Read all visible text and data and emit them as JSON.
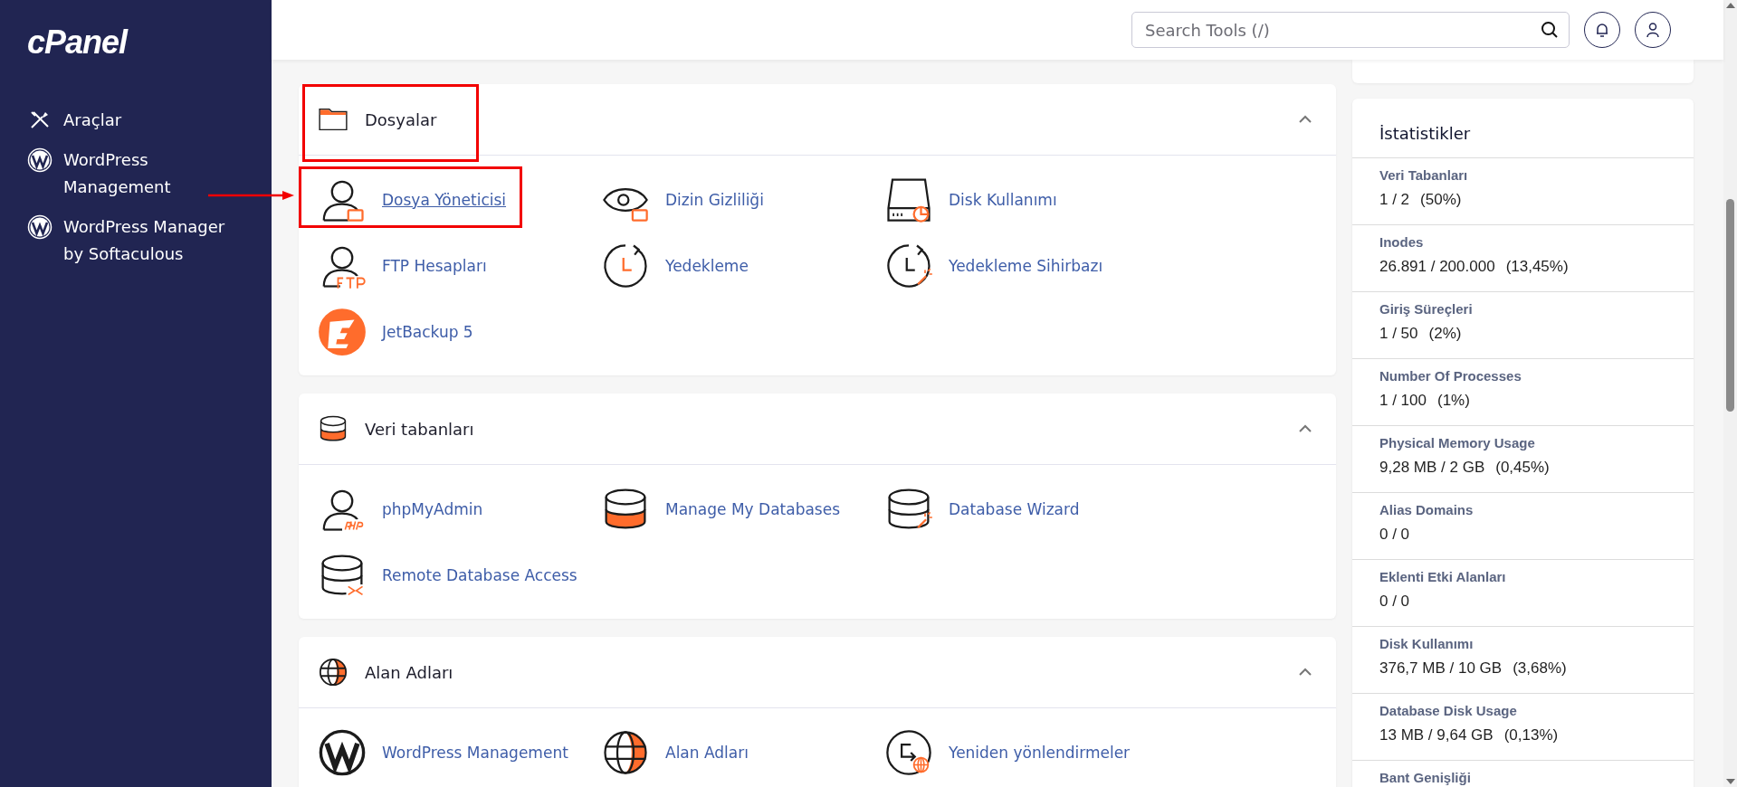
{
  "sidebar": {
    "logo": "cPanel",
    "items": [
      {
        "label": "Araçlar"
      },
      {
        "label": "WordPress Management"
      },
      {
        "label": "WordPress Manager by Softaculous"
      }
    ]
  },
  "header": {
    "search": {
      "placeholder": "Search Tools (/)"
    }
  },
  "sections": [
    {
      "title": "Dosyalar",
      "expanded": true,
      "highlighted": true,
      "items": [
        {
          "label": "Dosya Yöneticisi",
          "highlighted": true
        },
        {
          "label": "Dizin Gizliliği",
          "highlighted": false
        },
        {
          "label": "Disk Kullanımı",
          "highlighted": false
        },
        {
          "label": "FTP Hesapları",
          "highlighted": false
        },
        {
          "label": "Yedekleme",
          "highlighted": false
        },
        {
          "label": "Yedekleme Sihirbazı",
          "highlighted": false
        },
        {
          "label": "JetBackup 5",
          "highlighted": false
        }
      ]
    },
    {
      "title": "Veri tabanları",
      "expanded": true,
      "highlighted": false,
      "items": [
        {
          "label": "phpMyAdmin",
          "highlighted": false
        },
        {
          "label": "Manage My Databases",
          "highlighted": false
        },
        {
          "label": "Database Wizard",
          "highlighted": false
        },
        {
          "label": "Remote Database Access",
          "highlighted": false
        }
      ]
    },
    {
      "title": "Alan Adları",
      "expanded": true,
      "highlighted": false,
      "items": [
        {
          "label": "WordPress Management",
          "highlighted": false
        },
        {
          "label": "Alan Adları",
          "highlighted": false
        },
        {
          "label": "Yeniden yönlendirmeler",
          "highlighted": false
        }
      ]
    }
  ],
  "stats": {
    "title": "İstatistikler",
    "rows": [
      {
        "label": "Veri Tabanları",
        "value": "1 / 2",
        "percent": "(50%)"
      },
      {
        "label": "Inodes",
        "value": "26.891 / 200.000",
        "percent": "(13,45%)"
      },
      {
        "label": "Giriş Süreçleri",
        "value": "1 / 50",
        "percent": "(2%)"
      },
      {
        "label": "Number Of Processes",
        "value": "1 / 100",
        "percent": "(1%)"
      },
      {
        "label": "Physical Memory Usage",
        "value": "9,28 MB / 2 GB",
        "percent": "(0,45%)"
      },
      {
        "label": "Alias Domains",
        "value": "0 / 0"
      },
      {
        "label": "Eklenti Etki Alanları",
        "value": "0 / 0"
      },
      {
        "label": "Disk Kullanımı",
        "value": "376,7 MB / 10 GB",
        "percent": "(3,68%)"
      },
      {
        "label": "Database Disk Usage",
        "value": "13 MB / 9,64 GB",
        "percent": "(0,13%)"
      },
      {
        "label": "Bant Genişliği"
      }
    ]
  }
}
